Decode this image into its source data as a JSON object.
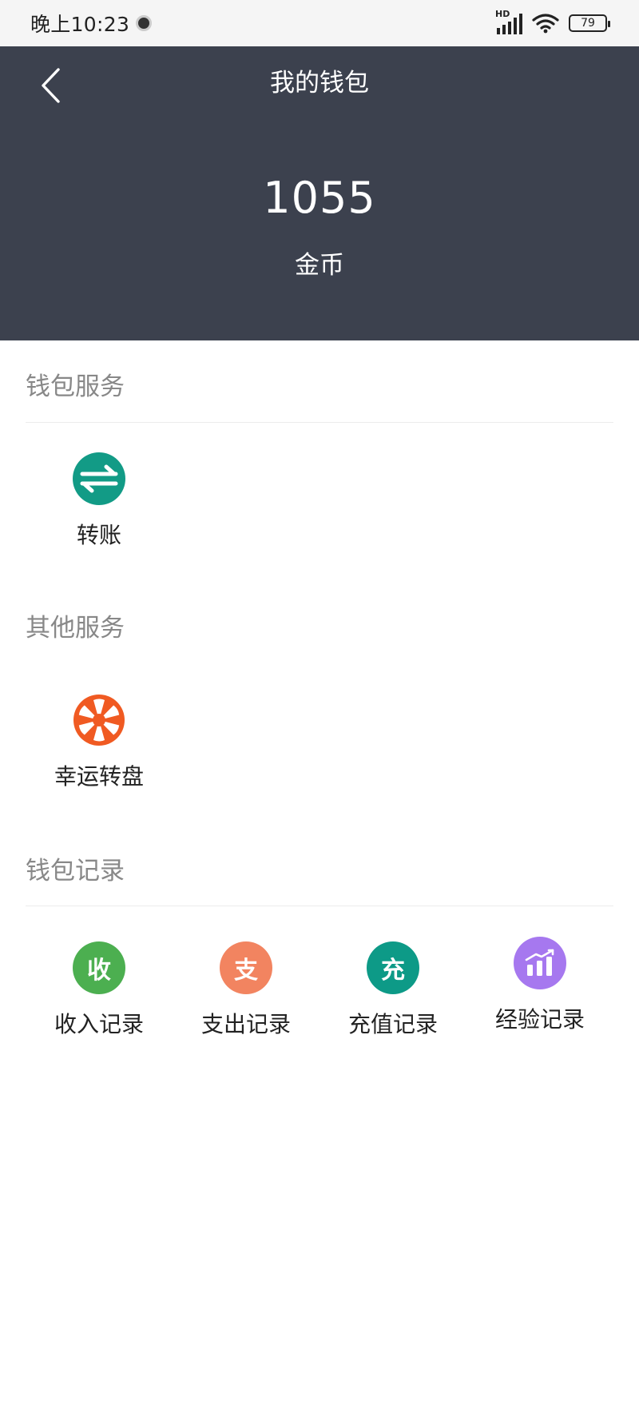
{
  "status_bar": {
    "time": "晚上10:23",
    "network": "HD",
    "battery": "79"
  },
  "header": {
    "title": "我的钱包",
    "balance": "1055",
    "unit": "金币",
    "background_color": "#3c414e"
  },
  "sections": {
    "wallet_services": {
      "title": "钱包服务",
      "items": [
        {
          "label": "转账",
          "icon": "transfer-icon",
          "color": "#129b86"
        }
      ]
    },
    "other_services": {
      "title": "其他服务",
      "items": [
        {
          "label": "幸运转盘",
          "icon": "wheel-icon",
          "color": "#f05a22"
        }
      ]
    },
    "wallet_records": {
      "title": "钱包记录",
      "items": [
        {
          "label": "收入记录",
          "icon_text": "收",
          "icon": "income-icon",
          "color": "#4caf50"
        },
        {
          "label": "支出记录",
          "icon_text": "支",
          "icon": "expense-icon",
          "color": "#f28460"
        },
        {
          "label": "充值记录",
          "icon_text": "充",
          "icon": "recharge-icon",
          "color": "#0d9a87"
        },
        {
          "label": "经验记录",
          "icon": "experience-chart-icon",
          "color": "#a678ef"
        }
      ]
    }
  }
}
